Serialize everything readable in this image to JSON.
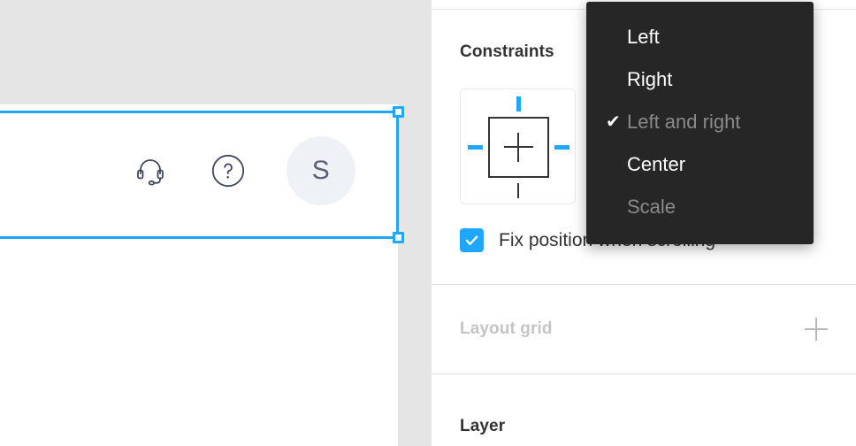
{
  "canvas": {
    "frame": {
      "name": "header-frame",
      "icons": [
        {
          "name": "headset-icon",
          "label": "Support headset"
        },
        {
          "name": "help-circle-icon",
          "label": "?"
        }
      ],
      "avatar": {
        "name": "avatar",
        "initial": "S"
      }
    },
    "selection": {
      "color": "#1ea7fd"
    }
  },
  "panel": {
    "constraints": {
      "title": "Constraints",
      "widget_name": "constraints-widget",
      "fix_position": {
        "label": "Fix position when scrolling",
        "checked": true,
        "check_glyph": "✓"
      }
    },
    "layout_grid": {
      "title": "Layout grid",
      "add_label": "+"
    },
    "layer": {
      "title": "Layer"
    }
  },
  "dropdown": {
    "name": "horizontal-constraint-menu",
    "check_glyph": "✔",
    "items": [
      {
        "label": "Left",
        "selected": false,
        "disabled": false
      },
      {
        "label": "Right",
        "selected": false,
        "disabled": false
      },
      {
        "label": "Left and right",
        "selected": true,
        "disabled": true
      },
      {
        "label": "Center",
        "selected": false,
        "disabled": false
      },
      {
        "label": "Scale",
        "selected": false,
        "disabled": true
      }
    ]
  },
  "colors": {
    "accent": "#1ea7fd",
    "menu_bg": "#262626",
    "canvas_bg": "#e5e5e5",
    "muted_text": "#c4c4c4"
  }
}
